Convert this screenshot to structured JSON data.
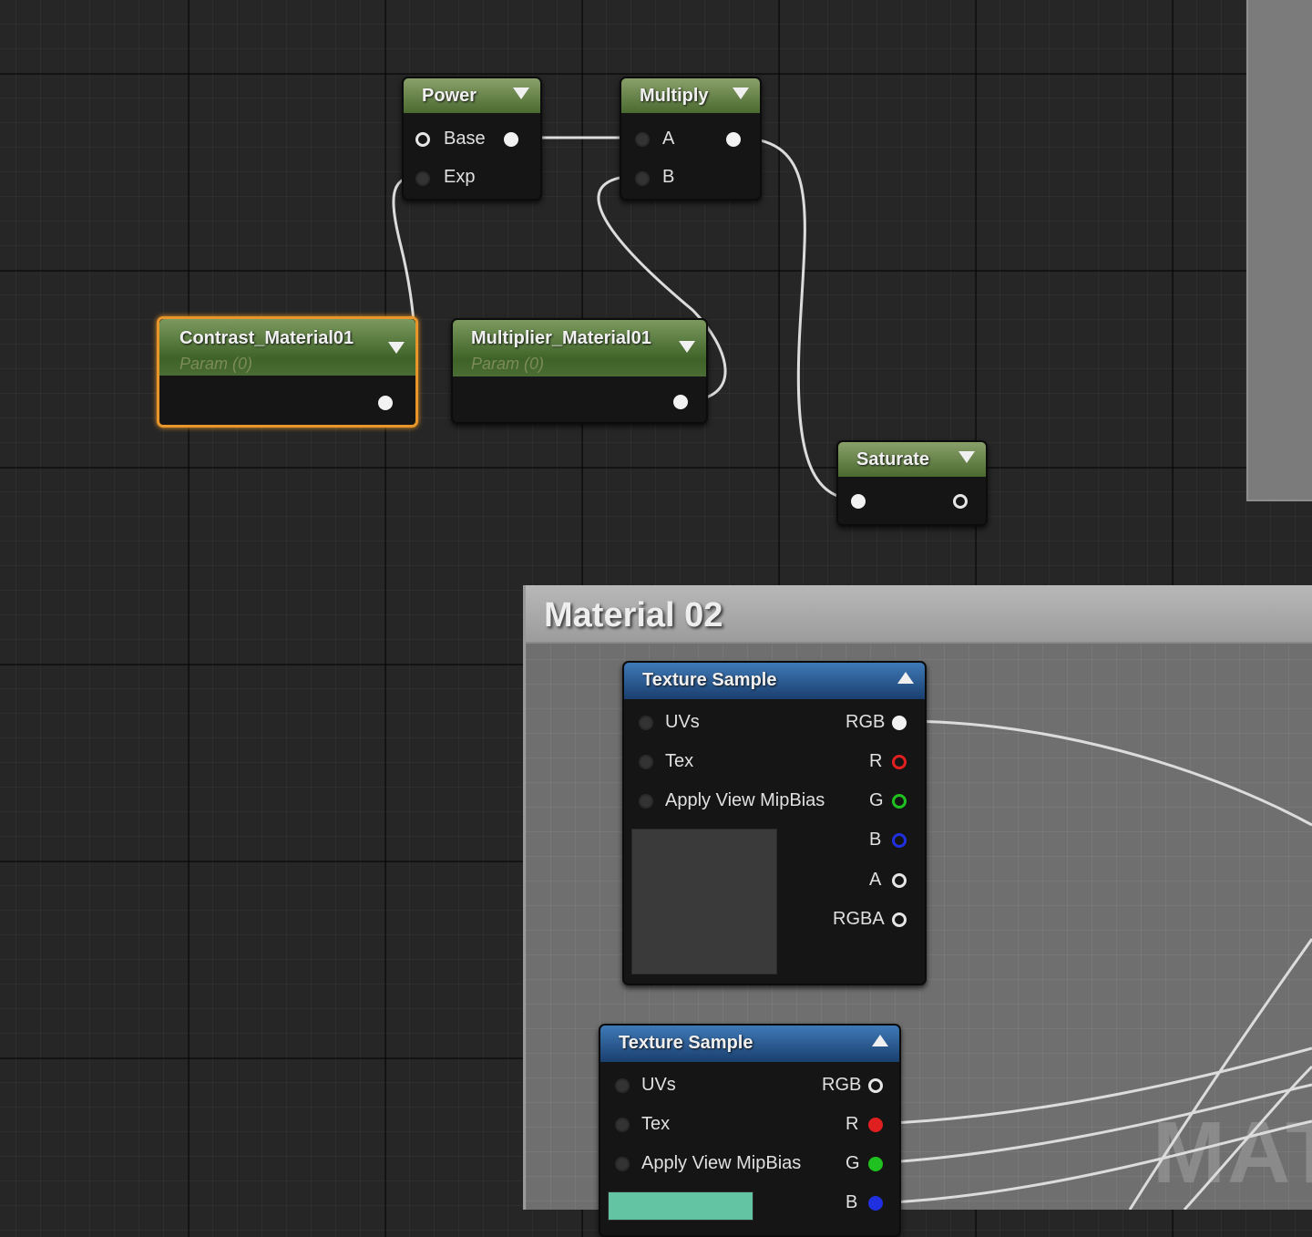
{
  "nodes": {
    "power": {
      "title": "Power",
      "inputs": [
        "Base",
        "Exp"
      ]
    },
    "multiply": {
      "title": "Multiply",
      "inputs": [
        "A",
        "B"
      ]
    },
    "contrast": {
      "title": "Contrast_Material01",
      "subtitle": "Param (0)"
    },
    "multiplier": {
      "title": "Multiplier_Material01",
      "subtitle": "Param (0)"
    },
    "saturate": {
      "title": "Saturate"
    },
    "texture_sample_1": {
      "title": "Texture Sample",
      "inputs": [
        "UVs",
        "Tex",
        "Apply View MipBias"
      ],
      "outputs": [
        "RGB",
        "R",
        "G",
        "B",
        "A",
        "RGBA"
      ]
    },
    "texture_sample_2": {
      "title": "Texture Sample",
      "inputs": [
        "UVs",
        "Tex",
        "Apply View MipBias"
      ],
      "outputs": [
        "RGB",
        "R",
        "G",
        "B"
      ]
    }
  },
  "comment": {
    "title": "Material 02"
  },
  "watermark": "MAT",
  "colors": {
    "pin_red": "#e02020",
    "pin_green": "#20c020",
    "pin_blue": "#2030e0",
    "selection": "#e8962a",
    "preview_teal": "#63c4a4"
  }
}
